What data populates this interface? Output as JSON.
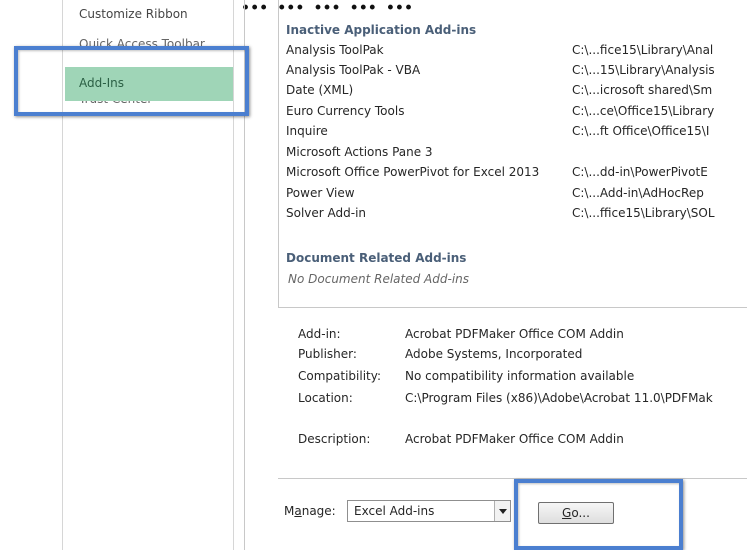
{
  "heading_fragment": "... ... ... ... ... ... ... ... ... ...",
  "sidebar": {
    "items": [
      {
        "label": "Customize Ribbon"
      },
      {
        "label": "Quick Access Toolbar"
      },
      {
        "label": "Add-Ins"
      },
      {
        "label": "Trust Center"
      }
    ]
  },
  "addins_list": {
    "inactive_header": "Inactive Application Add-ins",
    "inactive": [
      {
        "name": "Analysis ToolPak",
        "location": "C:\\...fice15\\Library\\Anal"
      },
      {
        "name": "Analysis ToolPak - VBA",
        "location": "C:\\...15\\Library\\Analysis"
      },
      {
        "name": "Date (XML)",
        "location": "C:\\...icrosoft shared\\Sm"
      },
      {
        "name": "Euro Currency Tools",
        "location": "C:\\...ce\\Office15\\Library"
      },
      {
        "name": "Inquire",
        "location": "C:\\...ft Office\\Office15\\I"
      },
      {
        "name": "Microsoft Actions Pane 3",
        "location": ""
      },
      {
        "name": "Microsoft Office PowerPivot for Excel 2013",
        "location": "C:\\...dd-in\\PowerPivotE"
      },
      {
        "name": "Power View",
        "location": "C:\\...Add-in\\AdHocRep"
      },
      {
        "name": "Solver Add-in",
        "location": "C:\\...ffice15\\Library\\SOL"
      }
    ],
    "document_header": "Document Related Add-ins",
    "document_note": "No Document Related Add-ins"
  },
  "details": {
    "addin_label": "Add-in:",
    "addin_value": "Acrobat PDFMaker Office COM Addin",
    "publisher_label": "Publisher:",
    "publisher_value": "Adobe Systems, Incorporated",
    "compatibility_label": "Compatibility:",
    "compatibility_value": "No compatibility information available",
    "location_label": "Location:",
    "location_value": "C:\\Program Files (x86)\\Adobe\\Acrobat 11.0\\PDFMak",
    "description_label": "Description:",
    "description_value": "Acrobat PDFMaker Office COM Addin"
  },
  "manage": {
    "label_prefix": "M",
    "label_underlined": "a",
    "label_suffix": "nage:",
    "selected": "Excel Add-ins",
    "go_underlined": "G",
    "go_suffix": "o..."
  },
  "colors": {
    "active_item_bg": "#9fd5b7",
    "highlight_border": "#4b7fd0",
    "section_header": "#4a5f78"
  }
}
